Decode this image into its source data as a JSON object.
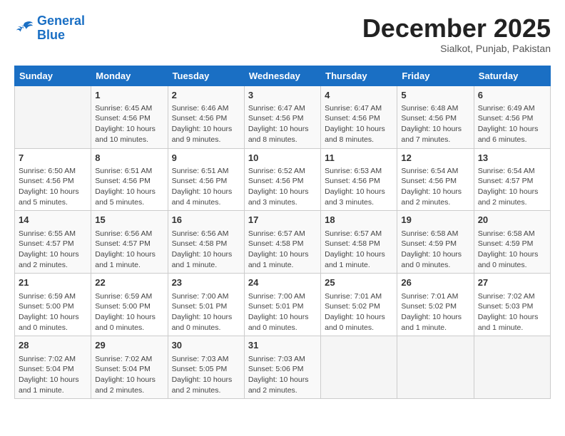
{
  "logo": {
    "line1": "General",
    "line2": "Blue"
  },
  "title": "December 2025",
  "subtitle": "Sialkot, Punjab, Pakistan",
  "days_of_week": [
    "Sunday",
    "Monday",
    "Tuesday",
    "Wednesday",
    "Thursday",
    "Friday",
    "Saturday"
  ],
  "weeks": [
    [
      {
        "day": "",
        "info": ""
      },
      {
        "day": "1",
        "info": "Sunrise: 6:45 AM\nSunset: 4:56 PM\nDaylight: 10 hours\nand 10 minutes."
      },
      {
        "day": "2",
        "info": "Sunrise: 6:46 AM\nSunset: 4:56 PM\nDaylight: 10 hours\nand 9 minutes."
      },
      {
        "day": "3",
        "info": "Sunrise: 6:47 AM\nSunset: 4:56 PM\nDaylight: 10 hours\nand 8 minutes."
      },
      {
        "day": "4",
        "info": "Sunrise: 6:47 AM\nSunset: 4:56 PM\nDaylight: 10 hours\nand 8 minutes."
      },
      {
        "day": "5",
        "info": "Sunrise: 6:48 AM\nSunset: 4:56 PM\nDaylight: 10 hours\nand 7 minutes."
      },
      {
        "day": "6",
        "info": "Sunrise: 6:49 AM\nSunset: 4:56 PM\nDaylight: 10 hours\nand 6 minutes."
      }
    ],
    [
      {
        "day": "7",
        "info": "Sunrise: 6:50 AM\nSunset: 4:56 PM\nDaylight: 10 hours\nand 5 minutes."
      },
      {
        "day": "8",
        "info": "Sunrise: 6:51 AM\nSunset: 4:56 PM\nDaylight: 10 hours\nand 5 minutes."
      },
      {
        "day": "9",
        "info": "Sunrise: 6:51 AM\nSunset: 4:56 PM\nDaylight: 10 hours\nand 4 minutes."
      },
      {
        "day": "10",
        "info": "Sunrise: 6:52 AM\nSunset: 4:56 PM\nDaylight: 10 hours\nand 3 minutes."
      },
      {
        "day": "11",
        "info": "Sunrise: 6:53 AM\nSunset: 4:56 PM\nDaylight: 10 hours\nand 3 minutes."
      },
      {
        "day": "12",
        "info": "Sunrise: 6:54 AM\nSunset: 4:56 PM\nDaylight: 10 hours\nand 2 minutes."
      },
      {
        "day": "13",
        "info": "Sunrise: 6:54 AM\nSunset: 4:57 PM\nDaylight: 10 hours\nand 2 minutes."
      }
    ],
    [
      {
        "day": "14",
        "info": "Sunrise: 6:55 AM\nSunset: 4:57 PM\nDaylight: 10 hours\nand 2 minutes."
      },
      {
        "day": "15",
        "info": "Sunrise: 6:56 AM\nSunset: 4:57 PM\nDaylight: 10 hours\nand 1 minute."
      },
      {
        "day": "16",
        "info": "Sunrise: 6:56 AM\nSunset: 4:58 PM\nDaylight: 10 hours\nand 1 minute."
      },
      {
        "day": "17",
        "info": "Sunrise: 6:57 AM\nSunset: 4:58 PM\nDaylight: 10 hours\nand 1 minute."
      },
      {
        "day": "18",
        "info": "Sunrise: 6:57 AM\nSunset: 4:58 PM\nDaylight: 10 hours\nand 1 minute."
      },
      {
        "day": "19",
        "info": "Sunrise: 6:58 AM\nSunset: 4:59 PM\nDaylight: 10 hours\nand 0 minutes."
      },
      {
        "day": "20",
        "info": "Sunrise: 6:58 AM\nSunset: 4:59 PM\nDaylight: 10 hours\nand 0 minutes."
      }
    ],
    [
      {
        "day": "21",
        "info": "Sunrise: 6:59 AM\nSunset: 5:00 PM\nDaylight: 10 hours\nand 0 minutes."
      },
      {
        "day": "22",
        "info": "Sunrise: 6:59 AM\nSunset: 5:00 PM\nDaylight: 10 hours\nand 0 minutes."
      },
      {
        "day": "23",
        "info": "Sunrise: 7:00 AM\nSunset: 5:01 PM\nDaylight: 10 hours\nand 0 minutes."
      },
      {
        "day": "24",
        "info": "Sunrise: 7:00 AM\nSunset: 5:01 PM\nDaylight: 10 hours\nand 0 minutes."
      },
      {
        "day": "25",
        "info": "Sunrise: 7:01 AM\nSunset: 5:02 PM\nDaylight: 10 hours\nand 0 minutes."
      },
      {
        "day": "26",
        "info": "Sunrise: 7:01 AM\nSunset: 5:02 PM\nDaylight: 10 hours\nand 1 minute."
      },
      {
        "day": "27",
        "info": "Sunrise: 7:02 AM\nSunset: 5:03 PM\nDaylight: 10 hours\nand 1 minute."
      }
    ],
    [
      {
        "day": "28",
        "info": "Sunrise: 7:02 AM\nSunset: 5:04 PM\nDaylight: 10 hours\nand 1 minute."
      },
      {
        "day": "29",
        "info": "Sunrise: 7:02 AM\nSunset: 5:04 PM\nDaylight: 10 hours\nand 2 minutes."
      },
      {
        "day": "30",
        "info": "Sunrise: 7:03 AM\nSunset: 5:05 PM\nDaylight: 10 hours\nand 2 minutes."
      },
      {
        "day": "31",
        "info": "Sunrise: 7:03 AM\nSunset: 5:06 PM\nDaylight: 10 hours\nand 2 minutes."
      },
      {
        "day": "",
        "info": ""
      },
      {
        "day": "",
        "info": ""
      },
      {
        "day": "",
        "info": ""
      }
    ]
  ]
}
